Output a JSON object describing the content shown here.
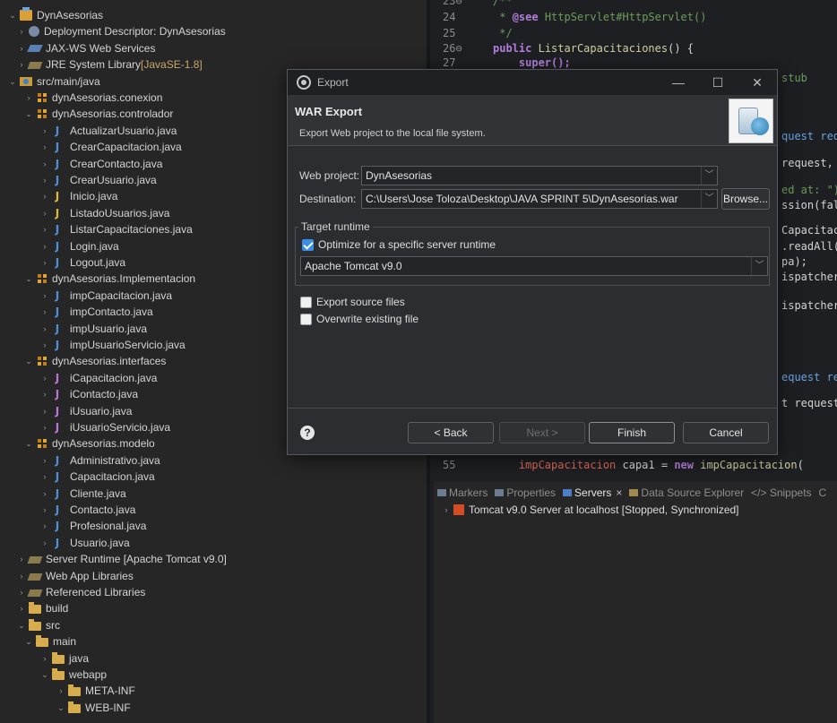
{
  "explorer": {
    "items": [
      {
        "label": "DynAsesorias",
        "arrow": "v",
        "icon": "project"
      },
      {
        "label": "Deployment Descriptor: DynAsesorias",
        "arrow": ">",
        "icon": "gear"
      },
      {
        "label": "JAX-WS Web Services",
        "arrow": ">",
        "icon": "ws"
      },
      {
        "label": "JRE System Library",
        "deco": "[JavaSE-1.8]",
        "arrow": ">",
        "icon": "lib"
      },
      {
        "label": "src/main/java",
        "arrow": "v",
        "icon": "srcfolder"
      },
      {
        "label": "dynAsesorias.conexion",
        "arrow": ">",
        "icon": "pkg"
      },
      {
        "label": "dynAsesorias.controlador",
        "arrow": "v",
        "icon": "pkg"
      },
      {
        "label": "ActualizarUsuario.java",
        "arrow": ">",
        "icon": "J"
      },
      {
        "label": "CrearCapacitacion.java",
        "arrow": ">",
        "icon": "J"
      },
      {
        "label": "CrearContacto.java",
        "arrow": ">",
        "icon": "J"
      },
      {
        "label": "CrearUsuario.java",
        "arrow": ">",
        "icon": "J"
      },
      {
        "label": "Inicio.java",
        "arrow": ">",
        "icon": "Jw"
      },
      {
        "label": "ListadoUsuarios.java",
        "arrow": ">",
        "icon": "Jw"
      },
      {
        "label": "ListarCapacitaciones.java",
        "arrow": ">",
        "icon": "J"
      },
      {
        "label": "Login.java",
        "arrow": ">",
        "icon": "J"
      },
      {
        "label": "Logout.java",
        "arrow": ">",
        "icon": "J"
      },
      {
        "label": "dynAsesorias.Implementacion",
        "arrow": "v",
        "icon": "pkg"
      },
      {
        "label": "impCapacitacion.java",
        "arrow": ">",
        "icon": "J"
      },
      {
        "label": "impContacto.java",
        "arrow": ">",
        "icon": "J"
      },
      {
        "label": "impUsuario.java",
        "arrow": ">",
        "icon": "J"
      },
      {
        "label": "impUsuarioServicio.java",
        "arrow": ">",
        "icon": "J"
      },
      {
        "label": "dynAsesorias.interfaces",
        "arrow": "v",
        "icon": "pkg"
      },
      {
        "label": "iCapacitacion.java",
        "arrow": ">",
        "icon": "I"
      },
      {
        "label": "iContacto.java",
        "arrow": ">",
        "icon": "I"
      },
      {
        "label": "iUsuario.java",
        "arrow": ">",
        "icon": "I"
      },
      {
        "label": "iUsuarioServicio.java",
        "arrow": ">",
        "icon": "I"
      },
      {
        "label": "dynAsesorias.modelo",
        "arrow": "v",
        "icon": "pkg"
      },
      {
        "label": "Administrativo.java",
        "arrow": ">",
        "icon": "J"
      },
      {
        "label": "Capacitacion.java",
        "arrow": ">",
        "icon": "J"
      },
      {
        "label": "Cliente.java",
        "arrow": ">",
        "icon": "J"
      },
      {
        "label": "Contacto.java",
        "arrow": ">",
        "icon": "J"
      },
      {
        "label": "Profesional.java",
        "arrow": ">",
        "icon": "J"
      },
      {
        "label": "Usuario.java",
        "arrow": ">",
        "icon": "J"
      },
      {
        "label": "Server Runtime [Apache Tomcat v9.0]",
        "arrow": ">",
        "icon": "lib"
      },
      {
        "label": "Web App Libraries",
        "arrow": ">",
        "icon": "lib"
      },
      {
        "label": "Referenced Libraries",
        "arrow": ">",
        "icon": "lib"
      },
      {
        "label": "build",
        "arrow": ">",
        "icon": "folder"
      },
      {
        "label": "src",
        "arrow": "v",
        "icon": "folder"
      },
      {
        "label": "main",
        "arrow": "v",
        "icon": "folder"
      },
      {
        "label": "java",
        "arrow": ">",
        "icon": "folder"
      },
      {
        "label": "webapp",
        "arrow": "v",
        "icon": "folder"
      },
      {
        "label": "META-INF",
        "arrow": ">",
        "icon": "folder"
      },
      {
        "label": "WEB-INF",
        "arrow": "v",
        "icon": "folder"
      }
    ]
  },
  "editor": {
    "lines": [
      {
        "num": "23⊖",
        "code": "/**",
        "cls": "cm"
      },
      {
        "num": "24",
        "code": " * @see HttpServlet#HttpServlet()",
        "cls": "cm"
      },
      {
        "num": "25",
        "code": " */",
        "cls": "cm"
      },
      {
        "num": "26⊖",
        "code": "public ListarCapacitaciones() {",
        "cls": "mix1"
      },
      {
        "num": "27",
        "code": "    super();",
        "cls": "kw"
      },
      {
        "num": "55",
        "code": "    impCapacitacion capa1 = new impCapacitacion(",
        "cls": "mix2"
      }
    ],
    "fragments": [
      "stub",
      "quest req",
      "request,",
      "ed at: \")",
      "ssion(fal",
      "Capacitac",
      ".readAll(",
      "pa);",
      "ispatcher",
      "ispatcher",
      "equest re",
      "t request"
    ]
  },
  "bottom": {
    "tabs": [
      {
        "label": "Markers",
        "active": false
      },
      {
        "label": "Properties",
        "active": false
      },
      {
        "label": "Servers",
        "active": true,
        "close": "×"
      },
      {
        "label": "Data Source Explorer",
        "active": false
      },
      {
        "label": "</> Snippets",
        "active": false
      },
      {
        "label": "C",
        "active": false
      }
    ],
    "server": "Tomcat v9.0 Server at localhost  [Stopped, Synchronized]"
  },
  "dialog": {
    "title": "Export",
    "minimize": "—",
    "maximize": "☐",
    "close": "✕",
    "heading": "WAR Export",
    "description": "Export Web project to the local file system.",
    "web_project_label": "Web project:",
    "web_project_value": "DynAsesorias",
    "destination_label": "Destination:",
    "destination_value": "C:\\Users\\Jose Toloza\\Desktop\\JAVA SPRINT 5\\DynAsesorias.war",
    "browse_label": "Browse...",
    "target_runtime_label": "Target runtime",
    "optimize_label": "Optimize for a specific server runtime",
    "optimize_checked": true,
    "runtime_value": "Apache Tomcat v9.0",
    "export_source_label": "Export source files",
    "export_source_checked": false,
    "overwrite_label": "Overwrite existing file",
    "overwrite_checked": false,
    "help_label": "?",
    "back_label": "< Back",
    "next_label": "Next >",
    "finish_label": "Finish",
    "cancel_label": "Cancel"
  }
}
